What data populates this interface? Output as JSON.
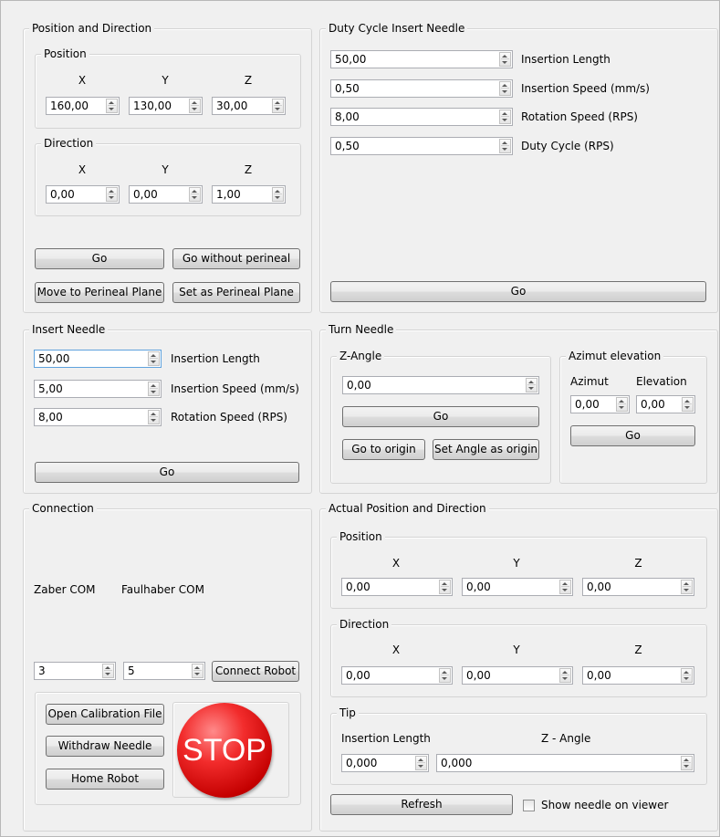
{
  "position_direction": {
    "title": "Position and Direction",
    "position": {
      "title": "Position",
      "labels": [
        "X",
        "Y",
        "Z"
      ],
      "values": [
        "160,00",
        "130,00",
        "30,00"
      ]
    },
    "direction": {
      "title": "Direction",
      "labels": [
        "X",
        "Y",
        "Z"
      ],
      "values": [
        "0,00",
        "0,00",
        "1,00"
      ]
    },
    "go_button": "Go",
    "go_without_perineal_button": "Go without perineal",
    "move_to_perineal_button": "Move to Perineal Plane",
    "set_perineal_button": "Set as Perineal Plane"
  },
  "duty_cycle": {
    "title": "Duty Cycle Insert Needle",
    "fields": [
      {
        "value": "50,00",
        "label": "Insertion Length"
      },
      {
        "value": "0,50",
        "label": "Insertion Speed (mm/s)"
      },
      {
        "value": "8,00",
        "label": "Rotation Speed (RPS)"
      },
      {
        "value": "0,50",
        "label": "Duty Cycle (RPS)"
      }
    ],
    "go_button": "Go"
  },
  "insert_needle": {
    "title": "Insert Needle",
    "fields": [
      {
        "value": "50,00",
        "label": "Insertion Length"
      },
      {
        "value": "5,00",
        "label": "Insertion Speed (mm/s)"
      },
      {
        "value": "8,00",
        "label": "Rotation Speed (RPS)"
      }
    ],
    "go_button": "Go"
  },
  "turn_needle": {
    "title": "Turn Needle",
    "z_angle": {
      "title": "Z-Angle",
      "value": "0,00",
      "go_button": "Go",
      "go_to_origin_button": "Go to origin",
      "set_angle_origin_button": "Set Angle as origin"
    },
    "azimut_elevation": {
      "title": "Azimut  elevation",
      "azimut_label": "Azimut",
      "elevation_label": "Elevation",
      "azimut_value": "0,00",
      "elevation_value": "0,00",
      "go_button": "Go"
    }
  },
  "connection": {
    "title": "Connection",
    "zaber_label": "Zaber COM",
    "faulhaber_label": "Faulhaber COM",
    "zaber_value": "3",
    "faulhaber_value": "5",
    "connect_button": "Connect Robot",
    "open_calibration_button": "Open Calibration File",
    "withdraw_button": "Withdraw Needle",
    "home_button": "Home Robot",
    "stop_label": "STOP"
  },
  "actual": {
    "title": "Actual Position and Direction",
    "position": {
      "title": "Position",
      "labels": [
        "X",
        "Y",
        "Z"
      ],
      "values": [
        "0,00",
        "0,00",
        "0,00"
      ]
    },
    "direction": {
      "title": "Direction",
      "labels": [
        "X",
        "Y",
        "Z"
      ],
      "values": [
        "0,00",
        "0,00",
        "0,00"
      ]
    },
    "tip": {
      "title": "Tip",
      "insertion_length_label": "Insertion Length",
      "z_angle_label": "Z - Angle",
      "insertion_length_value": "0,000",
      "z_angle_value": "0,000"
    },
    "refresh_button": "Refresh",
    "show_needle_label": "Show needle on viewer"
  },
  "colors": {
    "window_bg": "#f0f0f0",
    "stop_red": "#e01010",
    "focus_border": "#5fa2dd"
  }
}
